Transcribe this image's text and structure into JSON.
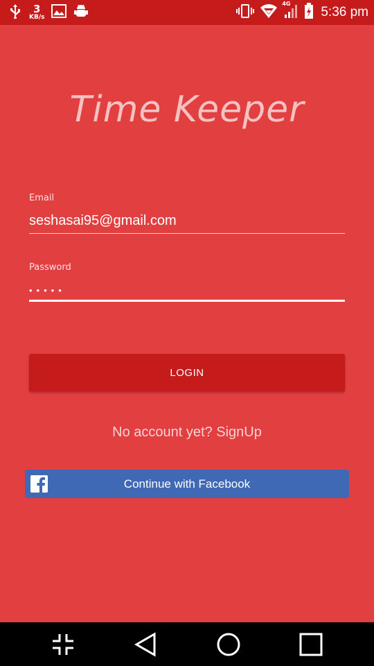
{
  "status_bar": {
    "net_speed_value": "3",
    "net_speed_unit": "KB/s",
    "network_type": "4G",
    "time": "5:36 pm",
    "icons_left": [
      "usb-icon",
      "image-icon",
      "android-debug-icon"
    ],
    "icons_right": [
      "vibrate-icon",
      "wifi-icon",
      "signal-icon",
      "battery-icon"
    ]
  },
  "app": {
    "title": "Time Keeper"
  },
  "form": {
    "email_label": "Email",
    "email_value": "seshasai95@gmail.com",
    "password_label": "Password",
    "password_masked": "•••••",
    "login_label": "LOGIN",
    "signup_text": "No account yet? SignUp",
    "facebook_label": "Continue with Facebook"
  },
  "colors": {
    "background": "#E24040",
    "status_bar": "#C61B1B",
    "login_button": "#C61B1B",
    "facebook_button": "#3F68B5",
    "title": "#F6C1C1"
  },
  "nav_bar": {
    "buttons": [
      "minimize-icon",
      "back-icon",
      "home-icon",
      "recents-icon"
    ]
  }
}
